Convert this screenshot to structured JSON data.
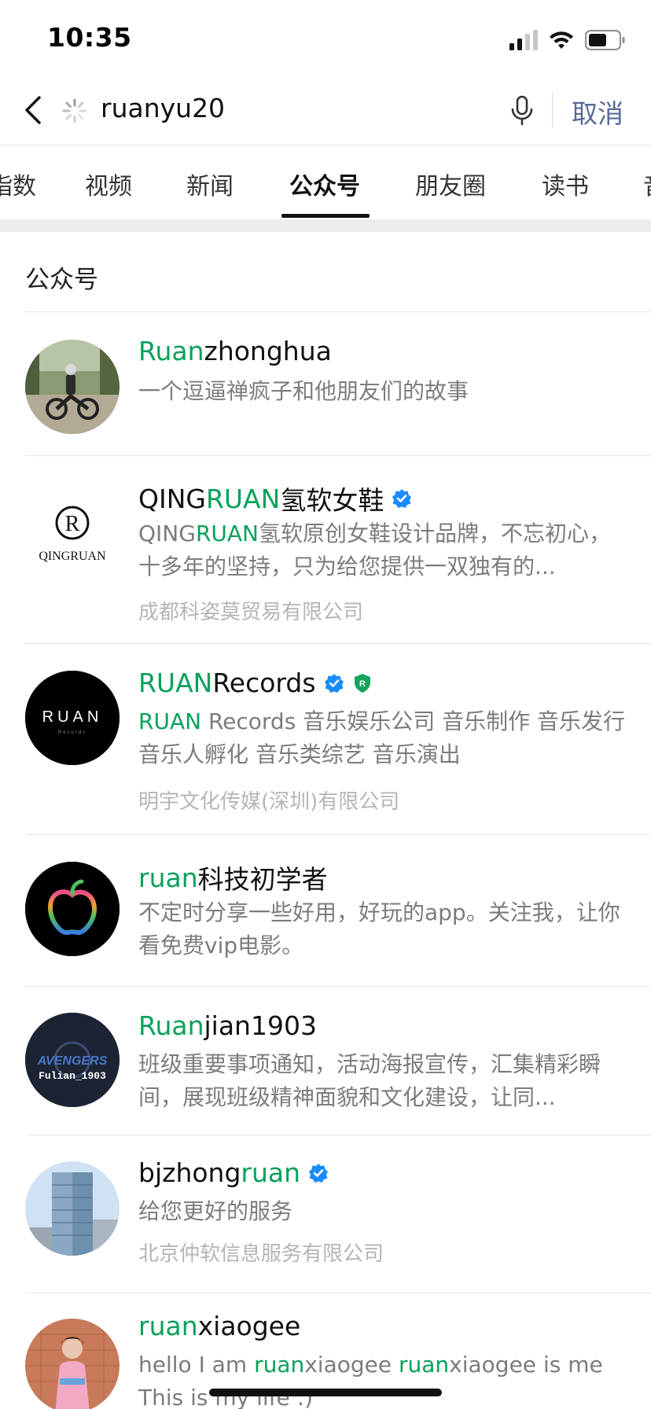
{
  "status_bar": {
    "time": "10:35"
  },
  "search": {
    "query": "ruanyu20",
    "cancel_label": "取消"
  },
  "tabs": [
    "指数",
    "视频",
    "新闻",
    "公众号",
    "朋友圈",
    "读书",
    "音"
  ],
  "active_tab": "公众号",
  "section": {
    "title": "公众号"
  },
  "results": [
    {
      "title_hl": "Ruan",
      "title_rest": "zhonghua",
      "desc": "一个逗逼禅疯子和他朋友们的故事"
    },
    {
      "title_pre": "QING",
      "title_hl": "RUAN",
      "title_rest": "氢软女鞋",
      "logo_text": "QINGRUAN",
      "desc_pre": "QING",
      "desc_hl": "RUAN",
      "desc_rest": "氢软原创女鞋设计品牌，不忘初心，十多年的坚持，只为给您提供一双独有的...",
      "org": "成都科姿莫贸易有限公司"
    },
    {
      "title_hl": "RUAN",
      "title_rest": " Records",
      "logo_text": "RUAN",
      "logo_sub": "Records",
      "desc_hl": "RUAN",
      "desc_rest": " Records 音乐娱乐公司 音乐制作 音乐发行 音乐人孵化 音乐类综艺 音乐演出",
      "org": "明宇文化传媒(深圳)有限公司"
    },
    {
      "title_hl": "ruan",
      "title_rest": "科技初学者",
      "desc": "不定时分享一些好用，好玩的app。关注我，让你看免费vip电影。"
    },
    {
      "title_hl": "Ruan",
      "title_rest": "jian1903",
      "logo_text": "AVENGERS",
      "logo_sub": "Fulian_1903",
      "desc": "班级重要事项通知，活动海报宣传，汇集精彩瞬间，展现班级精神面貌和文化建设，让同..."
    },
    {
      "title_pre": "bjzhong",
      "title_hl": "ruan",
      "title_rest": "",
      "desc": "给您更好的服务",
      "org": "北京仲软信息服务有限公司"
    },
    {
      "title_hl": "ruan",
      "title_rest": "xiaogee",
      "desc_pre": "hello I am ",
      "desc_hl": "ruan",
      "desc_mid": "xiaogee ",
      "desc_hl2": "ruan",
      "desc_rest": "xiaogee is me This is my life :)"
    }
  ],
  "colors": {
    "highlight": "#07a15a",
    "link_blue": "#576b95",
    "verified_blue": "#1a8cff",
    "shield_green": "#13a55c"
  }
}
